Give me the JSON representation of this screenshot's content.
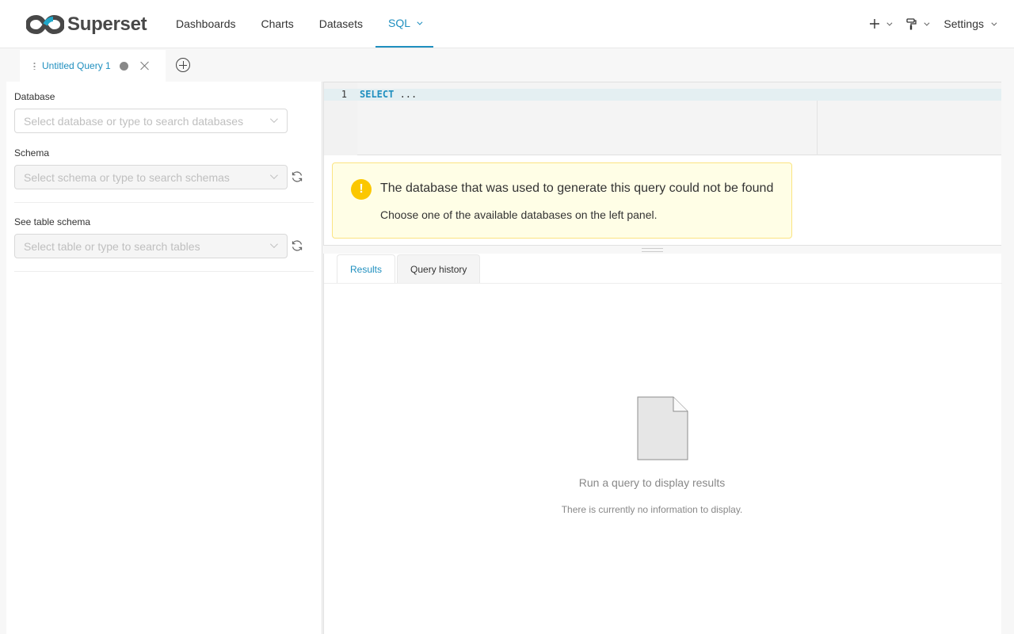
{
  "app": {
    "name": "Superset"
  },
  "nav": {
    "items": [
      {
        "label": "Dashboards"
      },
      {
        "label": "Charts"
      },
      {
        "label": "Datasets"
      },
      {
        "label": "SQL"
      }
    ],
    "active": "SQL",
    "settings_label": "Settings"
  },
  "query_tabs": [
    {
      "label": "Untitled Query 1"
    }
  ],
  "left_panel": {
    "database": {
      "label": "Database",
      "placeholder": "Select database or type to search databases"
    },
    "schema": {
      "label": "Schema",
      "placeholder": "Select schema or type to search schemas"
    },
    "table": {
      "label": "See table schema",
      "placeholder": "Select table or type to search tables"
    }
  },
  "editor": {
    "line_number": "1",
    "keyword": "SELECT",
    "rest": " ..."
  },
  "alert": {
    "title": "The database that was used to generate this query could not be found",
    "description": "Choose one of the available databases on the left panel."
  },
  "results": {
    "tabs": [
      {
        "label": "Results"
      },
      {
        "label": "Query history"
      }
    ],
    "empty_title": "Run a query to display results",
    "empty_description": "There is currently no information to display."
  },
  "colors": {
    "accent": "#1f8fbf",
    "warning": "#fbc700",
    "alert_bg": "#fffee6"
  }
}
